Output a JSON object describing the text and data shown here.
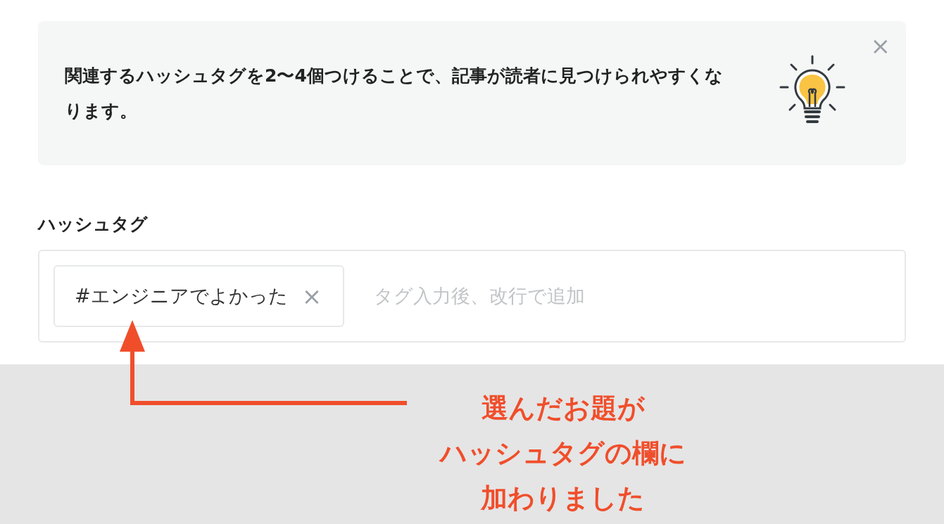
{
  "tip": {
    "text": "関連するハッシュタグを2〜4個つけることで、記事が読者に見つけられやすくなります。",
    "close": "×"
  },
  "hashtag_field": {
    "label": "ハッシュタグ",
    "tags": [
      {
        "text": "#エンジニアでよかった",
        "remove": "×"
      }
    ],
    "placeholder": "タグ入力後、改行で追加"
  },
  "annotation": {
    "lines": [
      "選んだお題が",
      "ハッシュタグの欄に",
      "加わりました"
    ]
  }
}
